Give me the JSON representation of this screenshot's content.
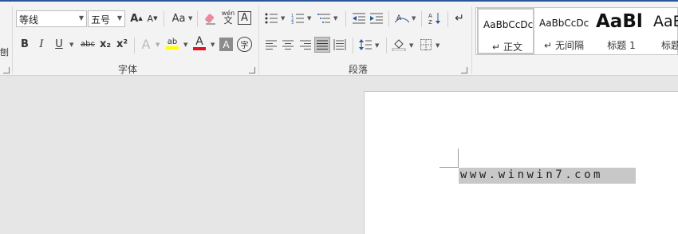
{
  "ribbon": {
    "font_group": {
      "label": "字体",
      "font_name": "等线",
      "font_size": "五号",
      "grow_font": "A",
      "shrink_font": "A",
      "change_case": "Aa",
      "phonetic_top": "wén",
      "phonetic_bottom": "文",
      "char_border": "A",
      "bold": "B",
      "italic": "I",
      "underline": "U",
      "strikethrough": "abc",
      "subscript": "x₂",
      "superscript": "x²",
      "text_effects": "A",
      "highlight": "ab",
      "font_color": "A",
      "char_shading": "A",
      "enclose_char": "字"
    },
    "paragraph_group": {
      "label": "段落"
    },
    "styles_group": {
      "items": [
        {
          "preview": "AaBbCcDc",
          "name": "正文",
          "mark": "↵"
        },
        {
          "preview": "AaBbCcDc",
          "name": "无间隔",
          "mark": "↵"
        },
        {
          "preview": "AaBl",
          "name": "标题 1"
        },
        {
          "preview": "AaBb",
          "name": "标题"
        }
      ]
    },
    "left_edge_char": "刨"
  },
  "document": {
    "selected_text": "www.winwin7.com"
  },
  "colors": {
    "accent": "#2b579a",
    "highlight_yellow": "#ffff00",
    "font_red": "#e81123",
    "selection": "#c8c8c8"
  }
}
